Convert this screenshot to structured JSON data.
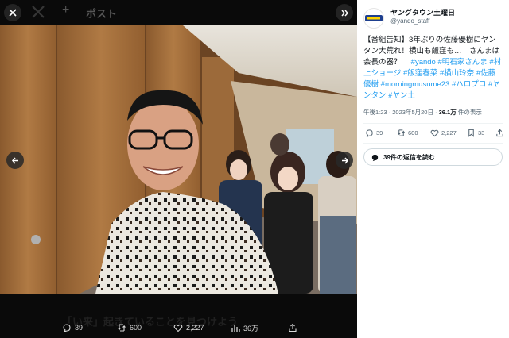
{
  "viewer": {
    "post_label": "ポスト",
    "caption_ghost": "「い来」起きていることを見つけよう",
    "actions": {
      "replies": "39",
      "reposts": "600",
      "likes": "2,227",
      "views": "36万"
    }
  },
  "tweet": {
    "account_name": "ヤングタウン土曜日",
    "handle": "@yando_staff",
    "text_main": "【番組告知】3年ぶりの佐藤優樹にヤンタン大荒れ！横山も飯窪も…　さんまは会長の器？　",
    "hashtags": [
      "#yando",
      "#明石家さんま",
      "#村上ショージ",
      "#飯窪春菜",
      "#横山玲奈",
      "#佐藤優樹",
      "#morningmusume23",
      "#ハロプロ",
      "#ヤンタン",
      "#ヤン土"
    ],
    "time": "午後1:23 · 2023年5月20日 · ",
    "views_count": "36.1万",
    "views_suffix": " 件の表示",
    "stats": {
      "replies": "39",
      "reposts": "600",
      "likes": "2,227",
      "bookmarks": "33"
    },
    "read_replies": "39件の返信を読む"
  },
  "colors": {
    "accent": "#1d9bf0",
    "panel_bg": "#ffffff",
    "viewer_bg": "#000000"
  }
}
